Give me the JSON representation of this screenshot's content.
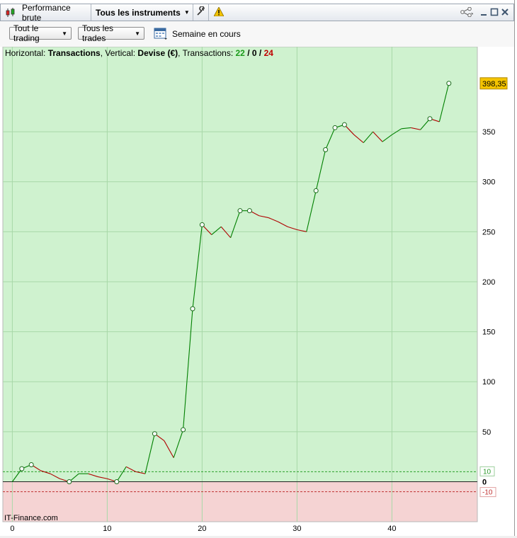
{
  "window": {
    "title": "Performance brute",
    "instrument_selector": "Tous les instruments"
  },
  "toolbar": {
    "trading_filter": "Tout le trading",
    "trades_filter": "Tous les trades",
    "period_label": "Semaine en cours"
  },
  "info": {
    "horizontal_prefix": "Horizontal: ",
    "horizontal_value": "Transactions",
    "vertical_prefix": ", Vertical: ",
    "vertical_value": "Devise (€)",
    "transactions_prefix": ", Transactions: ",
    "winning": "22",
    "sep1": " / ",
    "neutral": "0",
    "sep2": " / ",
    "losing": "24"
  },
  "watermark": "IT-Finance.com",
  "colors": {
    "positive_zone": "#cff2cf",
    "negative_zone": "#f5d3d3",
    "up_line": "#008000",
    "down_line": "#b00000",
    "last_value_badge": "#f5c400"
  },
  "chart_data": {
    "type": "line",
    "xlabel": "",
    "ylabel": "",
    "xlim": [
      -1,
      49
    ],
    "ylim": [
      -40,
      435
    ],
    "x_ticks": [
      "0",
      "10",
      "20",
      "30",
      "40"
    ],
    "x_tick_values": [
      0,
      10,
      20,
      30,
      40
    ],
    "y_ticks": [
      "50",
      "100",
      "150",
      "200",
      "250",
      "300",
      "350"
    ],
    "y_tick_values": [
      50,
      100,
      150,
      200,
      250,
      300,
      350
    ],
    "zero_label": "0",
    "upper_threshold_label": "10",
    "upper_threshold": 10,
    "lower_threshold_label": "-10",
    "lower_threshold": -10,
    "last_value_label": "398,35",
    "last_value": 398.35,
    "grid": true,
    "series": [
      {
        "x": [
          0,
          1,
          2,
          3,
          4,
          5,
          6,
          7,
          8,
          9,
          10,
          11,
          12,
          13,
          14,
          15,
          16,
          17,
          18,
          19,
          20,
          21,
          22,
          23,
          24,
          25,
          26,
          27,
          28,
          29,
          30,
          31,
          32,
          33,
          34,
          35,
          36,
          37,
          38,
          39,
          40,
          41,
          42,
          43,
          44,
          45,
          46
        ],
        "values": [
          0,
          13,
          17,
          11,
          8,
          3,
          0,
          8,
          8,
          5,
          3,
          0,
          15,
          10,
          8,
          48,
          41,
          24,
          52,
          173,
          257,
          247,
          255,
          244,
          271,
          271,
          266,
          264,
          260,
          255,
          252,
          250,
          291,
          332,
          354,
          357,
          347,
          339,
          350,
          340,
          347,
          353,
          354,
          352,
          363,
          360,
          398.35
        ],
        "markers": [
          1,
          2,
          6,
          11,
          15,
          18,
          19,
          20,
          24,
          25,
          32,
          33,
          34,
          35,
          44,
          46
        ]
      }
    ]
  }
}
